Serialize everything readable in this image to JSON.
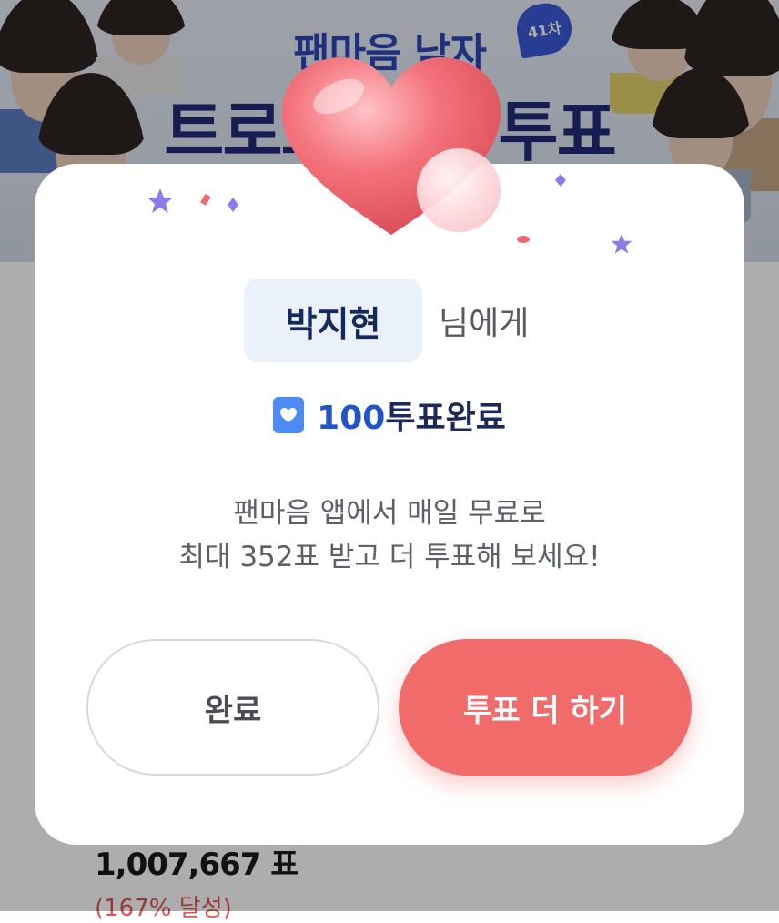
{
  "banner": {
    "title_line1": "팬마음 남자",
    "title_line2": "트로트 가수 투표",
    "round_badge": "41차"
  },
  "background": {
    "total_votes": "1,007,667 표",
    "achievement": "(167% 달성)"
  },
  "modal": {
    "recipient_name": "박지현",
    "recipient_suffix": "님에게",
    "vote_icon": "heart-icon",
    "vote_count": "100",
    "vote_status": "투표완료",
    "message_line1": "팬마음 앱에서 매일 무료로",
    "message_line2": "최대 352표 받고 더 투표해 보세요!",
    "done_button": "완료",
    "more_button": "투표 더 하기"
  },
  "colors": {
    "accent_red": "#f26b6b",
    "accent_blue": "#1f55c9",
    "chip_bg": "#eaf1fb",
    "heart": "#f06e78"
  }
}
